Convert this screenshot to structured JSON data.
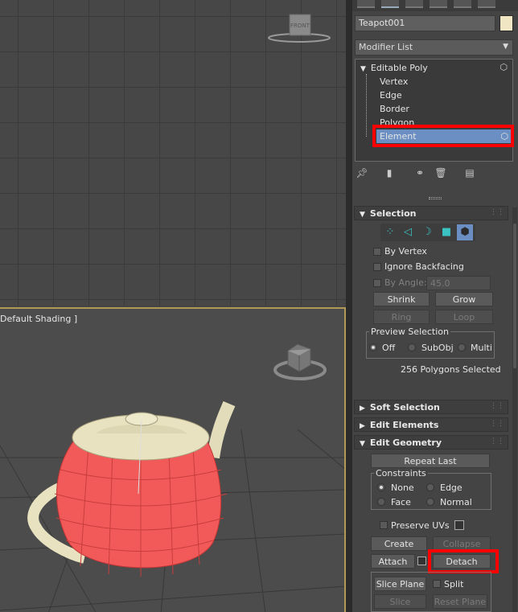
{
  "viewports": {
    "perspective_label": "Default Shading ]",
    "front_cube_label": "FRONT"
  },
  "panel": {
    "object_name": "Teapot001",
    "modifier_list": "Modifier List",
    "stack": {
      "root": "Editable Poly",
      "items": [
        "Vertex",
        "Edge",
        "Border",
        "Polygon",
        "Element"
      ]
    },
    "selection": {
      "title": "Selection",
      "by_vertex": "By Vertex",
      "ignore_backfacing": "Ignore Backfacing",
      "by_angle": "By Angle:",
      "angle_value": "45.0",
      "shrink": "Shrink",
      "grow": "Grow",
      "ring": "Ring",
      "loop": "Loop",
      "preview_title": "Preview Selection",
      "preview_off": "Off",
      "preview_subobj": "SubObj",
      "preview_multi": "Multi",
      "status": "256 Polygons Selected"
    },
    "soft_selection": "Soft Selection",
    "edit_elements": "Edit Elements",
    "edit_geometry": {
      "title": "Edit Geometry",
      "repeat_last": "Repeat Last",
      "constraints": "Constraints",
      "none": "None",
      "edge": "Edge",
      "face": "Face",
      "normal": "Normal",
      "preserve_uvs": "Preserve UVs",
      "create": "Create",
      "collapse": "Collapse",
      "attach": "Attach",
      "detach": "Detach",
      "slice_plane": "Slice Plane",
      "split": "Split",
      "slice": "Slice",
      "reset_plane": "Reset Plane"
    }
  },
  "colors": {
    "highlight": "#ff0000",
    "selection": "#6b8fc2",
    "teapot": "#f25a5a",
    "viewport_border": "#b19a55"
  }
}
